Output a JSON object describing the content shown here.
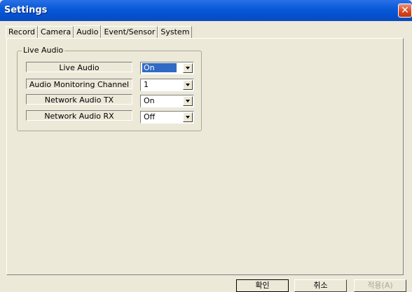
{
  "window": {
    "title": "Settings",
    "close_glyph": "✕"
  },
  "tabs": [
    {
      "label": "Record"
    },
    {
      "label": "Camera"
    },
    {
      "label": "Audio",
      "active": true
    },
    {
      "label": "Event/Sensor"
    },
    {
      "label": "System"
    }
  ],
  "group": {
    "title": "Live Audio",
    "rows": [
      {
        "label": "Live Audio",
        "value": "On"
      },
      {
        "label": "Audio Monitoring Channel",
        "value": "1"
      },
      {
        "label": "Network Audio TX",
        "value": "On"
      },
      {
        "label": "Network Audio RX",
        "value": "Off"
      }
    ]
  },
  "buttons": {
    "ok": "확인",
    "cancel": "취소",
    "apply": "적용(A)"
  }
}
